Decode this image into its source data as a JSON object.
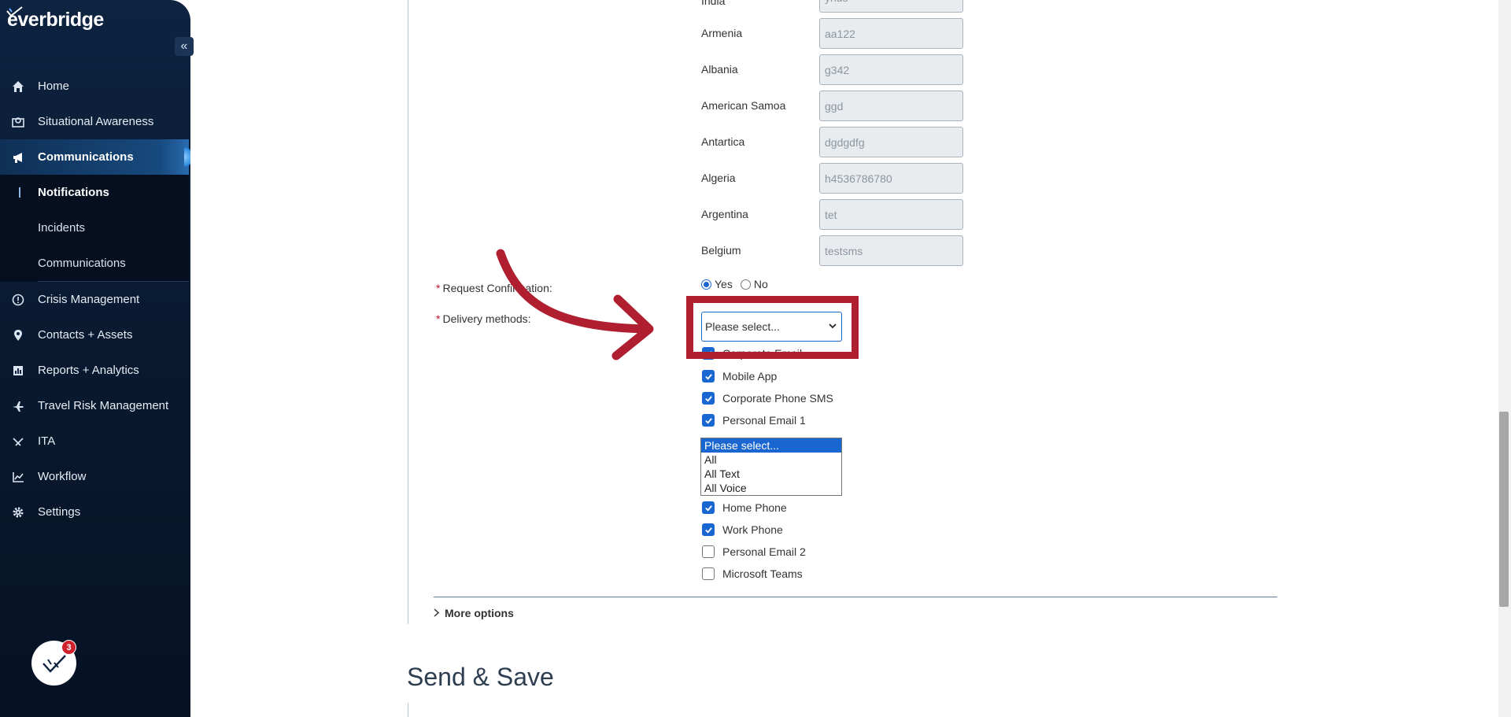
{
  "app": {
    "logo_text": "everbridge",
    "collapse_icon": "«"
  },
  "sidebar": {
    "items": [
      {
        "label": "Home",
        "icon": "home-icon"
      },
      {
        "label": "Situational Awareness",
        "icon": "map-icon"
      },
      {
        "label": "Communications",
        "icon": "megaphone-icon",
        "active": true
      },
      {
        "label": "Crisis Management",
        "icon": "alert-circle-icon"
      },
      {
        "label": "Contacts + Assets",
        "icon": "location-pin-icon"
      },
      {
        "label": "Reports + Analytics",
        "icon": "report-icon"
      },
      {
        "label": "Travel Risk Management",
        "icon": "plane-icon"
      },
      {
        "label": "ITA",
        "icon": "ita-icon"
      },
      {
        "label": "Workflow",
        "icon": "chart-line-icon"
      },
      {
        "label": "Settings",
        "icon": "gear-icon"
      }
    ],
    "sub_items": [
      {
        "label": "Notifications",
        "current": true
      },
      {
        "label": "Incidents"
      },
      {
        "label": "Communications"
      }
    ],
    "bot_badge": "3"
  },
  "form": {
    "partial_top_label": "India",
    "partial_top_value": "yhds",
    "country_rows": [
      {
        "label": "Armenia",
        "value": "aa122"
      },
      {
        "label": "Albania",
        "value": "g342"
      },
      {
        "label": "American Samoa",
        "value": "ggd"
      },
      {
        "label": "Antartica",
        "value": "dgdgdfg"
      },
      {
        "label": "Algeria",
        "value": "h4536786780"
      },
      {
        "label": "Argentina",
        "value": "tet"
      },
      {
        "label": "Belgium",
        "value": "testsms"
      }
    ],
    "request_confirmation": {
      "star": "*",
      "label": "Request Confirmation:",
      "yes_label": "Yes",
      "no_label": "No",
      "selected": "Yes"
    },
    "delivery_methods": {
      "star": "*",
      "label": "Delivery methods:",
      "select_value": "Please select...",
      "partial_item": "Corporate Email",
      "checkboxes_top": [
        {
          "label": "Mobile App",
          "checked": true
        },
        {
          "label": "Corporate Phone SMS",
          "checked": true
        },
        {
          "label": "Personal Email 1",
          "checked": true
        }
      ],
      "listbox_options": [
        "Please select...",
        "All",
        "All Text",
        "All Voice"
      ],
      "listbox_selected": "Please select...",
      "checkboxes_bottom": [
        {
          "label": "Home Phone",
          "checked": true
        },
        {
          "label": "Work Phone",
          "checked": true
        },
        {
          "label": "Personal Email 2",
          "checked": false
        },
        {
          "label": "Microsoft Teams",
          "checked": false
        }
      ]
    },
    "more_options": "More options"
  },
  "sections": {
    "send_save_title": "Send & Save"
  },
  "colors": {
    "sidebar_bg": "#0d2340",
    "accent_blue": "#1a66d0",
    "highlight_red": "#b01f2f",
    "required_star": "#c0142b"
  }
}
